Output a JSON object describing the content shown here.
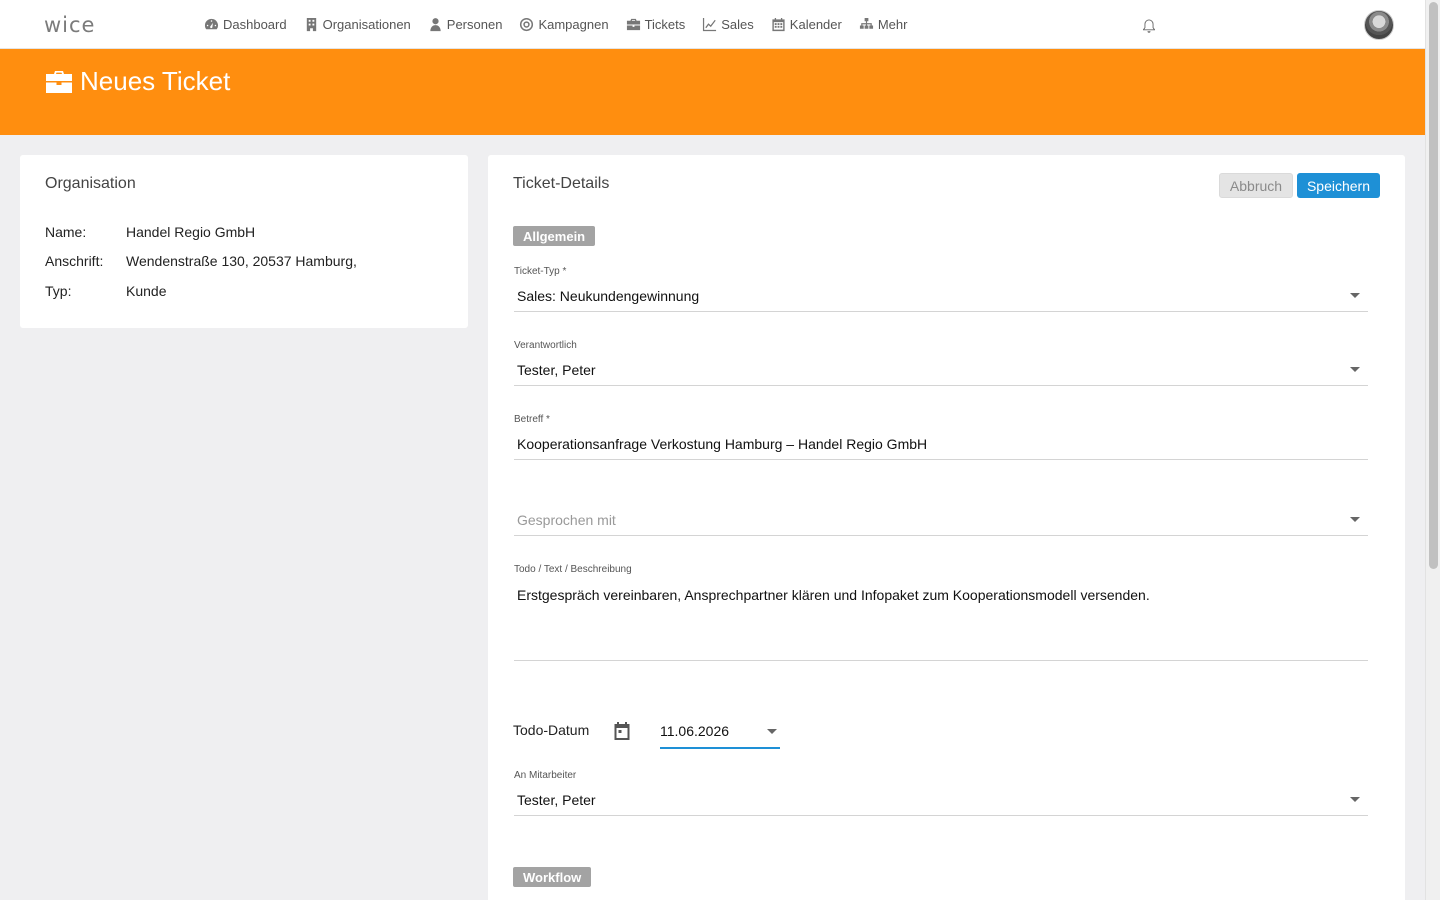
{
  "app": {
    "logo": "wice"
  },
  "nav": {
    "items": [
      {
        "label": "Dashboard",
        "icon": "dashboard-icon"
      },
      {
        "label": "Organisationen",
        "icon": "building-icon"
      },
      {
        "label": "Personen",
        "icon": "person-icon"
      },
      {
        "label": "Kampagnen",
        "icon": "target-icon"
      },
      {
        "label": "Tickets",
        "icon": "briefcase-icon"
      },
      {
        "label": "Sales",
        "icon": "line-chart-icon"
      },
      {
        "label": "Kalender",
        "icon": "calendar-icon"
      },
      {
        "label": "Mehr",
        "icon": "sitemap-icon"
      }
    ]
  },
  "header": {
    "title": "Neues Ticket",
    "icon": "briefcase-icon",
    "color": "#ff8e0f"
  },
  "organisation": {
    "title": "Organisation",
    "rows": [
      {
        "key": "Name:",
        "value": "Handel Regio GmbH"
      },
      {
        "key": "Anschrift:",
        "value": "Wendenstraße 130, 20537 Hamburg,"
      },
      {
        "key": "Typ:",
        "value": "Kunde"
      }
    ]
  },
  "ticket": {
    "title": "Ticket-Details",
    "cancel_label": "Abbruch",
    "save_label": "Speichern",
    "save_color": "#1e90d6",
    "section_general": "Allgemein",
    "section_workflow": "Workflow",
    "ticket_type": {
      "label": "Ticket-Typ *",
      "value": "Sales: Neukundengewinnung"
    },
    "responsible": {
      "label": "Verantwortlich",
      "value": "Tester, Peter"
    },
    "subject": {
      "label": "Betreff *",
      "value": "Kooperationsanfrage Verkostung Hamburg – Handel Regio GmbH"
    },
    "spoken_with": {
      "placeholder": "Gesprochen mit"
    },
    "description": {
      "label": "Todo / Text / Beschreibung",
      "value": "Erstgespräch vereinbaren, Ansprechpartner klären und Infopaket zum Kooperationsmodell versenden."
    },
    "todo_date": {
      "label": "Todo-Datum",
      "value": "11.06.2026"
    },
    "employee": {
      "label": "An Mitarbeiter",
      "value": "Tester, Peter"
    }
  }
}
